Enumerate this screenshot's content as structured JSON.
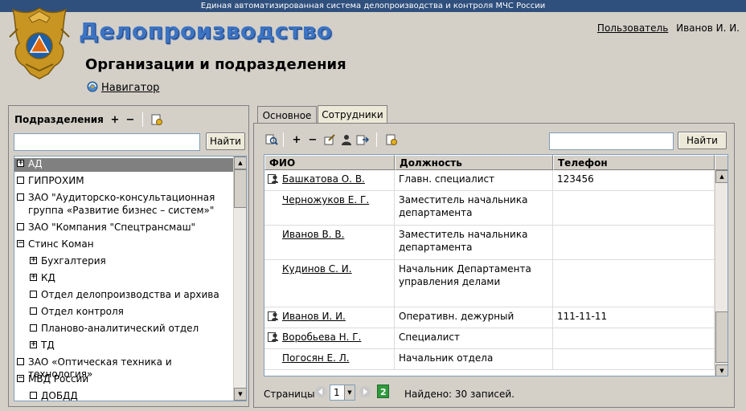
{
  "system_banner": "Единая автоматизированная система делопроизводства и контроля МЧС России",
  "app_title": "Делопроизводство",
  "user": {
    "link": "Пользователь",
    "name": "Иванов И. И."
  },
  "page_title": "Организации и подразделения",
  "navigator_label": "Навигатор",
  "left": {
    "heading": "Подразделения",
    "search_value": "",
    "find_button": "Найти",
    "tree": [
      {
        "label": "АД",
        "box": "+",
        "level": 0,
        "selected": true
      },
      {
        "label": "ГИПРОХИМ",
        "box": "",
        "level": 0
      },
      {
        "label": "ЗАО \"Аудиторско-консультационная",
        "box": "",
        "level": 0
      },
      {
        "label": "группа «Развитие бизнес – систем»\"",
        "box": "none",
        "level": 0
      },
      {
        "label": "ЗАО \"Компания \"Спецтрансмаш\"",
        "box": "",
        "level": 0
      },
      {
        "label": "Стинс Коман",
        "box": "−",
        "level": 0
      },
      {
        "label": "Бухгалтерия",
        "box": "+",
        "level": 1
      },
      {
        "label": "КД",
        "box": "+",
        "level": 1
      },
      {
        "label": "Отдел делопроизводства и архива",
        "box": "",
        "level": 1
      },
      {
        "label": "Отдел контроля",
        "box": "",
        "level": 1
      },
      {
        "label": "Планово-аналитический отдел",
        "box": "",
        "level": 1
      },
      {
        "label": "ТД",
        "box": "+",
        "level": 1
      },
      {
        "label": "ЗАО «Оптическая техника и технология»",
        "box": "",
        "level": 0
      },
      {
        "label": "МВД России",
        "box": "−",
        "level": 0
      },
      {
        "label": "ДОБДД",
        "box": "",
        "level": 1
      }
    ]
  },
  "tabs": [
    {
      "label": "Основное",
      "active": false
    },
    {
      "label": "Сотрудники",
      "active": true
    }
  ],
  "right": {
    "search_value": "",
    "find_button": "Найти",
    "columns": [
      "ФИО",
      "Должность",
      "Телефон"
    ],
    "rows": [
      {
        "name": "Башкатова О. В.",
        "position": "Главн. специалист",
        "phone": "123456",
        "icon": true
      },
      {
        "name": "Черножуков Е. Г.",
        "position": "Заместитель начальника департамента",
        "phone": "",
        "icon": false
      },
      {
        "name": "Иванов В. В.",
        "position": "Заместитель начальника департамента",
        "phone": "",
        "icon": false
      },
      {
        "name": "Кудинов С. И.",
        "position": "Начальник Департамента управления делами",
        "phone": "",
        "icon": false
      },
      {
        "name": "Иванов И. И.",
        "position": "Оперативн. дежурный",
        "phone": "111-11-11",
        "icon": true
      },
      {
        "name": "Воробьева Н. Г.",
        "position": "Специалист",
        "phone": "",
        "icon": true
      },
      {
        "name": "Погосян Е. Л.",
        "position": "Начальник отдела",
        "phone": "",
        "icon": false
      }
    ],
    "pager": {
      "label": "Страницы",
      "page": "1",
      "found": "Найдено: 30 записей."
    }
  },
  "colors": {
    "banner": "#2f4f7c",
    "title": "#3c73c2",
    "selection": "#808080",
    "panel": "#d4d0c8"
  }
}
